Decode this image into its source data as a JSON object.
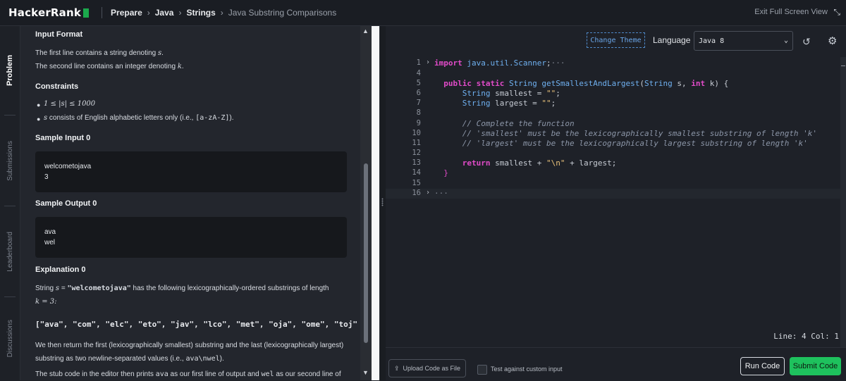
{
  "header": {
    "logo": "HackerRank",
    "breadcrumbs": [
      "Prepare",
      "Java",
      "Strings",
      "Java Substring Comparisons"
    ],
    "exit_fullscreen": "Exit Full Screen View"
  },
  "sidebar": {
    "tabs": [
      "Problem",
      "Submissions",
      "Leaderboard",
      "Discussions"
    ],
    "active": "Problem"
  },
  "problem": {
    "input_format_title": "Input Format",
    "input_line1_pre": "The first line contains a string denoting ",
    "input_line1_var": "s",
    "input_line1_post": ".",
    "input_line2_pre": "The second line contains an integer denoting ",
    "input_line2_var": "k",
    "input_line2_post": ".",
    "constraints_title": "Constraints",
    "constraint1": "1 ≤ |s| ≤ 1000",
    "constraint2_var": "s",
    "constraint2_pre": " consists of English alphabetic letters only (i.e., ",
    "constraint2_code": "[a-zA-Z]",
    "constraint2_post": ").",
    "sample_input_title": "Sample Input 0",
    "sample_input": [
      "welcometojava",
      "3"
    ],
    "sample_output_title": "Sample Output 0",
    "sample_output": [
      "ava",
      "wel"
    ],
    "explanation_title": "Explanation 0",
    "expl_pre": "String ",
    "expl_var": "s",
    "expl_eq": " = ",
    "expl_str": "\"welcometojava\"",
    "expl_post": " has the following lexicographically-ordered substrings of length",
    "expl_k": "k = 3:",
    "substrings": "[\"ava\", \"com\", \"elc\", \"eto\", \"jav\", \"lco\", \"met\", \"oja\", \"ome\", \"toj\"",
    "return_line1": "We then return the first (lexicographically smallest) substring and the last (lexicographically largest)",
    "return_line2_pre": "substring as two newline-separated values (i.e., ",
    "return_line2_code": "ava\\nwel",
    "return_line2_post": ").",
    "stub_pre": "The stub code in the editor then prints ",
    "stub_code1": "ava",
    "stub_mid": " as our first line of output and ",
    "stub_code2": "wel",
    "stub_post": " as our second line of"
  },
  "editor": {
    "change_theme": "Change Theme",
    "language_label": "Language",
    "language_value": "Java 8",
    "status": "Line: 4  Col: 1",
    "line_numbers": [
      "1",
      "4",
      "5",
      "6",
      "7",
      "8",
      "9",
      "10",
      "11",
      "12",
      "13",
      "14",
      "15",
      "16"
    ]
  },
  "bottom": {
    "upload_label": "Upload Code as File",
    "custom_input_label": "Test against custom input",
    "run_label": "Run Code",
    "submit_label": "Submit Code"
  }
}
